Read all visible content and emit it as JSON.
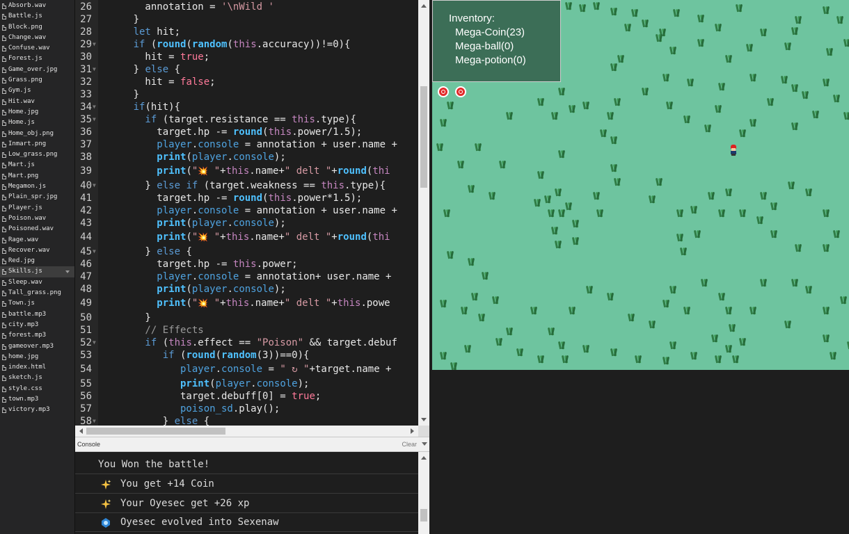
{
  "sidebar": {
    "files": [
      "Absorb.wav",
      "Battle.js",
      "Block.png",
      "Change.wav",
      "Confuse.wav",
      "Forest.js",
      "Game_over.jpg",
      "Grass.png",
      "Gym.js",
      "Hit.wav",
      "Home.jpg",
      "Home.js",
      "Home_obj.png",
      "Inmart.png",
      "Low_grass.png",
      "Mart.js",
      "Mart.png",
      "Megamon.js",
      "Plain_spr.jpg",
      "Player.js",
      "Poison.wav",
      "Poisoned.wav",
      "Rage.wav",
      "Recover.wav",
      "Red.jpg",
      "Skills.js",
      "Sleep.wav",
      "Tall_grass.png",
      "Town.js",
      "battle.mp3",
      "city.mp3",
      "forest.mp3",
      "gameover.mp3",
      "home.jpg",
      "index.html",
      "sketch.js",
      "style.css",
      "town.mp3",
      "victory.mp3"
    ],
    "selected_file": "Skills.js"
  },
  "editor": {
    "line_numbers": [
      "26",
      "27",
      "28",
      "29",
      "30",
      "31",
      "32",
      "33",
      "34",
      "35",
      "36",
      "37",
      "38",
      "39",
      "40",
      "41",
      "42",
      "43",
      "44",
      "45",
      "46",
      "47",
      "48",
      "49",
      "50",
      "51",
      "52",
      "53",
      "54",
      "55",
      "56",
      "57",
      "58"
    ],
    "lines": [
      [
        [
          "",
          "        annotation = "
        ],
        [
          "str",
          "'\\nWild '"
        ]
      ],
      [
        [
          "",
          "      }"
        ]
      ],
      [
        [
          "kw",
          "      let"
        ],
        [
          "",
          " hit;"
        ]
      ],
      [
        [
          "kw",
          "      if"
        ],
        [
          "",
          " ("
        ],
        [
          "fn",
          "round"
        ],
        [
          "",
          "("
        ],
        [
          "fn",
          "random"
        ],
        [
          "",
          "("
        ],
        [
          "this",
          "this"
        ],
        [
          "",
          ".accuracy))!=0){"
        ]
      ],
      [
        [
          "",
          "        hit = "
        ],
        [
          "lit",
          "true"
        ],
        [
          "",
          ";"
        ]
      ],
      [
        [
          "",
          "      } "
        ],
        [
          "kw",
          "else"
        ],
        [
          "",
          " {"
        ]
      ],
      [
        [
          "",
          "        hit = "
        ],
        [
          "lit",
          "false"
        ],
        [
          "",
          ";"
        ]
      ],
      [
        [
          "",
          "      }"
        ]
      ],
      [
        [
          "kw",
          "      if"
        ],
        [
          "",
          "(hit){"
        ]
      ],
      [
        [
          "kw",
          "        if"
        ],
        [
          "",
          " (target.resistance == "
        ],
        [
          "this",
          "this"
        ],
        [
          "",
          ".type){"
        ]
      ],
      [
        [
          "",
          "          target.hp -= "
        ],
        [
          "fn",
          "round"
        ],
        [
          "",
          "("
        ],
        [
          "this",
          "this"
        ],
        [
          "",
          ".power/1.5);"
        ]
      ],
      [
        [
          "prop",
          "          player"
        ],
        [
          "",
          "."
        ],
        [
          "prop",
          "console"
        ],
        [
          "",
          " = annotation + user.name + "
        ]
      ],
      [
        [
          "fn",
          "          print"
        ],
        [
          "",
          "("
        ],
        [
          "prop",
          "player"
        ],
        [
          "",
          "."
        ],
        [
          "prop",
          "console"
        ],
        [
          "",
          ");"
        ]
      ],
      [
        [
          "fn",
          "          print"
        ],
        [
          "",
          "("
        ],
        [
          "str",
          "\""
        ],
        [
          "boom",
          "💥"
        ],
        [
          "str",
          " \""
        ],
        [
          "",
          "+"
        ],
        [
          "this",
          "this"
        ],
        [
          "",
          ".name+"
        ],
        [
          "str",
          "\" delt \""
        ],
        [
          "",
          "+"
        ],
        [
          "fn",
          "round"
        ],
        [
          "",
          "("
        ],
        [
          "this",
          "thi"
        ]
      ],
      [
        [
          "",
          "        } "
        ],
        [
          "kw",
          "else if"
        ],
        [
          "",
          " (target.weakness == "
        ],
        [
          "this",
          "this"
        ],
        [
          "",
          ".type){"
        ]
      ],
      [
        [
          "",
          "          target.hp -= "
        ],
        [
          "fn",
          "round"
        ],
        [
          "",
          "("
        ],
        [
          "this",
          "this"
        ],
        [
          "",
          ".power*1.5);"
        ]
      ],
      [
        [
          "prop",
          "          player"
        ],
        [
          "",
          "."
        ],
        [
          "prop",
          "console"
        ],
        [
          "",
          " = annotation + user.name +"
        ]
      ],
      [
        [
          "fn",
          "          print"
        ],
        [
          "",
          "("
        ],
        [
          "prop",
          "player"
        ],
        [
          "",
          "."
        ],
        [
          "prop",
          "console"
        ],
        [
          "",
          ");"
        ]
      ],
      [
        [
          "fn",
          "          print"
        ],
        [
          "",
          "("
        ],
        [
          "str",
          "\""
        ],
        [
          "boom",
          "💥"
        ],
        [
          "str",
          " \""
        ],
        [
          "",
          "+"
        ],
        [
          "this",
          "this"
        ],
        [
          "",
          ".name+"
        ],
        [
          "str",
          "\" delt \""
        ],
        [
          "",
          "+"
        ],
        [
          "fn",
          "round"
        ],
        [
          "",
          "("
        ],
        [
          "this",
          "thi"
        ]
      ],
      [
        [
          "",
          "        } "
        ],
        [
          "kw",
          "else"
        ],
        [
          "",
          " {"
        ]
      ],
      [
        [
          "",
          "          target.hp -= "
        ],
        [
          "this",
          "this"
        ],
        [
          "",
          ".power;"
        ]
      ],
      [
        [
          "prop",
          "          player"
        ],
        [
          "",
          "."
        ],
        [
          "prop",
          "console"
        ],
        [
          "",
          " = annotation+ user.name + "
        ]
      ],
      [
        [
          "fn",
          "          print"
        ],
        [
          "",
          "("
        ],
        [
          "prop",
          "player"
        ],
        [
          "",
          "."
        ],
        [
          "prop",
          "console"
        ],
        [
          "",
          ");"
        ]
      ],
      [
        [
          "fn",
          "          print"
        ],
        [
          "",
          "("
        ],
        [
          "str",
          "\""
        ],
        [
          "boom",
          "💥"
        ],
        [
          "str",
          " \""
        ],
        [
          "",
          "+"
        ],
        [
          "this",
          "this"
        ],
        [
          "",
          ".name+"
        ],
        [
          "str",
          "\" delt \""
        ],
        [
          "",
          "+"
        ],
        [
          "this",
          "this"
        ],
        [
          "",
          ".powe"
        ]
      ],
      [
        [
          "",
          "        }"
        ]
      ],
      [
        [
          "cmt",
          "        // Effects"
        ]
      ],
      [
        [
          "kw",
          "        if"
        ],
        [
          "",
          " ("
        ],
        [
          "this",
          "this"
        ],
        [
          "",
          ".effect == "
        ],
        [
          "str",
          "\"Poison\""
        ],
        [
          "",
          " && target.debuf"
        ]
      ],
      [
        [
          "kw",
          "           if"
        ],
        [
          "",
          " ("
        ],
        [
          "fn",
          "round"
        ],
        [
          "",
          "("
        ],
        [
          "fn",
          "random"
        ],
        [
          "",
          "(3))==0){"
        ]
      ],
      [
        [
          "prop",
          "              player"
        ],
        [
          "",
          "."
        ],
        [
          "prop",
          "console"
        ],
        [
          "",
          " = "
        ],
        [
          "str",
          "\" ↻ \""
        ],
        [
          "",
          "+target.name + "
        ]
      ],
      [
        [
          "fn",
          "              print"
        ],
        [
          "",
          "("
        ],
        [
          "prop",
          "player"
        ],
        [
          "",
          "."
        ],
        [
          "prop",
          "console"
        ],
        [
          "",
          ");"
        ]
      ],
      [
        [
          "",
          "              target.debuff[0] = "
        ],
        [
          "lit",
          "true"
        ],
        [
          "",
          ";"
        ]
      ],
      [
        [
          "prop",
          "              poison_sd"
        ],
        [
          "",
          ".play();"
        ]
      ],
      [
        [
          "",
          "           } "
        ],
        [
          "kw",
          "else"
        ],
        [
          "",
          " {"
        ]
      ]
    ],
    "fold_markers": [
      "29",
      "31",
      "34",
      "35",
      "40",
      "45",
      "52",
      "58"
    ]
  },
  "console": {
    "title": "Console",
    "clear_label": "Clear",
    "messages": [
      {
        "icon": "",
        "text": "You Won the battle!"
      },
      {
        "icon": "sparkle-icon",
        "text": "You get +14 Coin"
      },
      {
        "icon": "sparkle-icon",
        "text": "Your Oyesec get +26 xp"
      },
      {
        "icon": "evolve-gem-icon",
        "text": "Oyesec evolved into Sexenaw"
      }
    ]
  },
  "game": {
    "background_color": "#6ec49f",
    "inventory": {
      "title": "Inventory:",
      "items": [
        "Mega-Coin(23)",
        "Mega-ball(0)",
        "Mega-potion(0)"
      ]
    },
    "pokeball_count": 2
  }
}
